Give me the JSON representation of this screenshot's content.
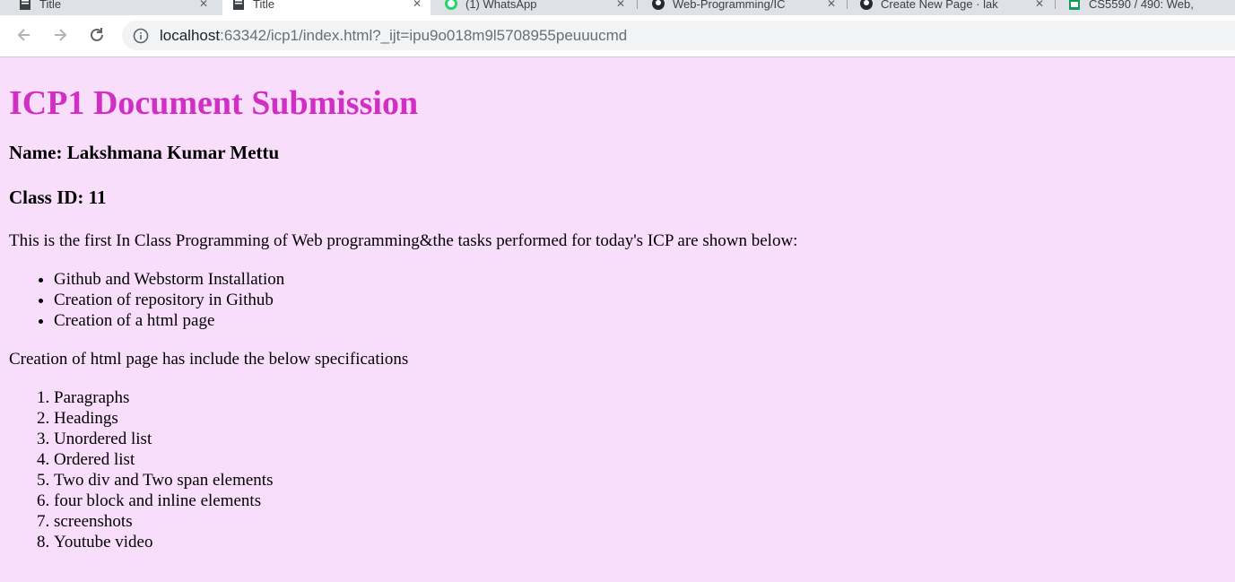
{
  "browser": {
    "tabs": [
      {
        "title": "Title",
        "active": false,
        "icon": "document-icon"
      },
      {
        "title": "Title",
        "active": true,
        "icon": "document-icon"
      },
      {
        "title": "(1) WhatsApp",
        "active": false,
        "icon": "whatsapp-icon"
      },
      {
        "title": "Web-Programming/IC",
        "active": false,
        "icon": "github-icon"
      },
      {
        "title": "Create New Page · lak",
        "active": false,
        "icon": "github-icon"
      },
      {
        "title": "CS5590 / 490: Web,",
        "active": false,
        "icon": "sheets-icon"
      }
    ],
    "address": {
      "host": "localhost",
      "rest": ":63342/icp1/index.html?_ijt=ipu9o018m9l5708955peuuucmd"
    }
  },
  "page": {
    "title": "ICP1 Document Submission",
    "name_heading": "Name: Lakshmana Kumar Mettu",
    "class_heading": "Class ID: 11",
    "intro": "This is the first In Class Programming of Web programming&the tasks performed for today's ICP are shown below:",
    "tasks": [
      "Github and Webstorm Installation",
      "Creation of repository in Github",
      "Creation of a html page"
    ],
    "spec_intro": "Creation of html page has include the below specifications",
    "specs": [
      "Paragraphs",
      "Headings",
      "Unordered list",
      "Ordered list",
      "Two div and Two span elements",
      "four block and inline elements",
      "screenshots",
      "Youtube video"
    ]
  },
  "colors": {
    "page_background": "#f9defb",
    "title_color": "#d12fc4"
  }
}
